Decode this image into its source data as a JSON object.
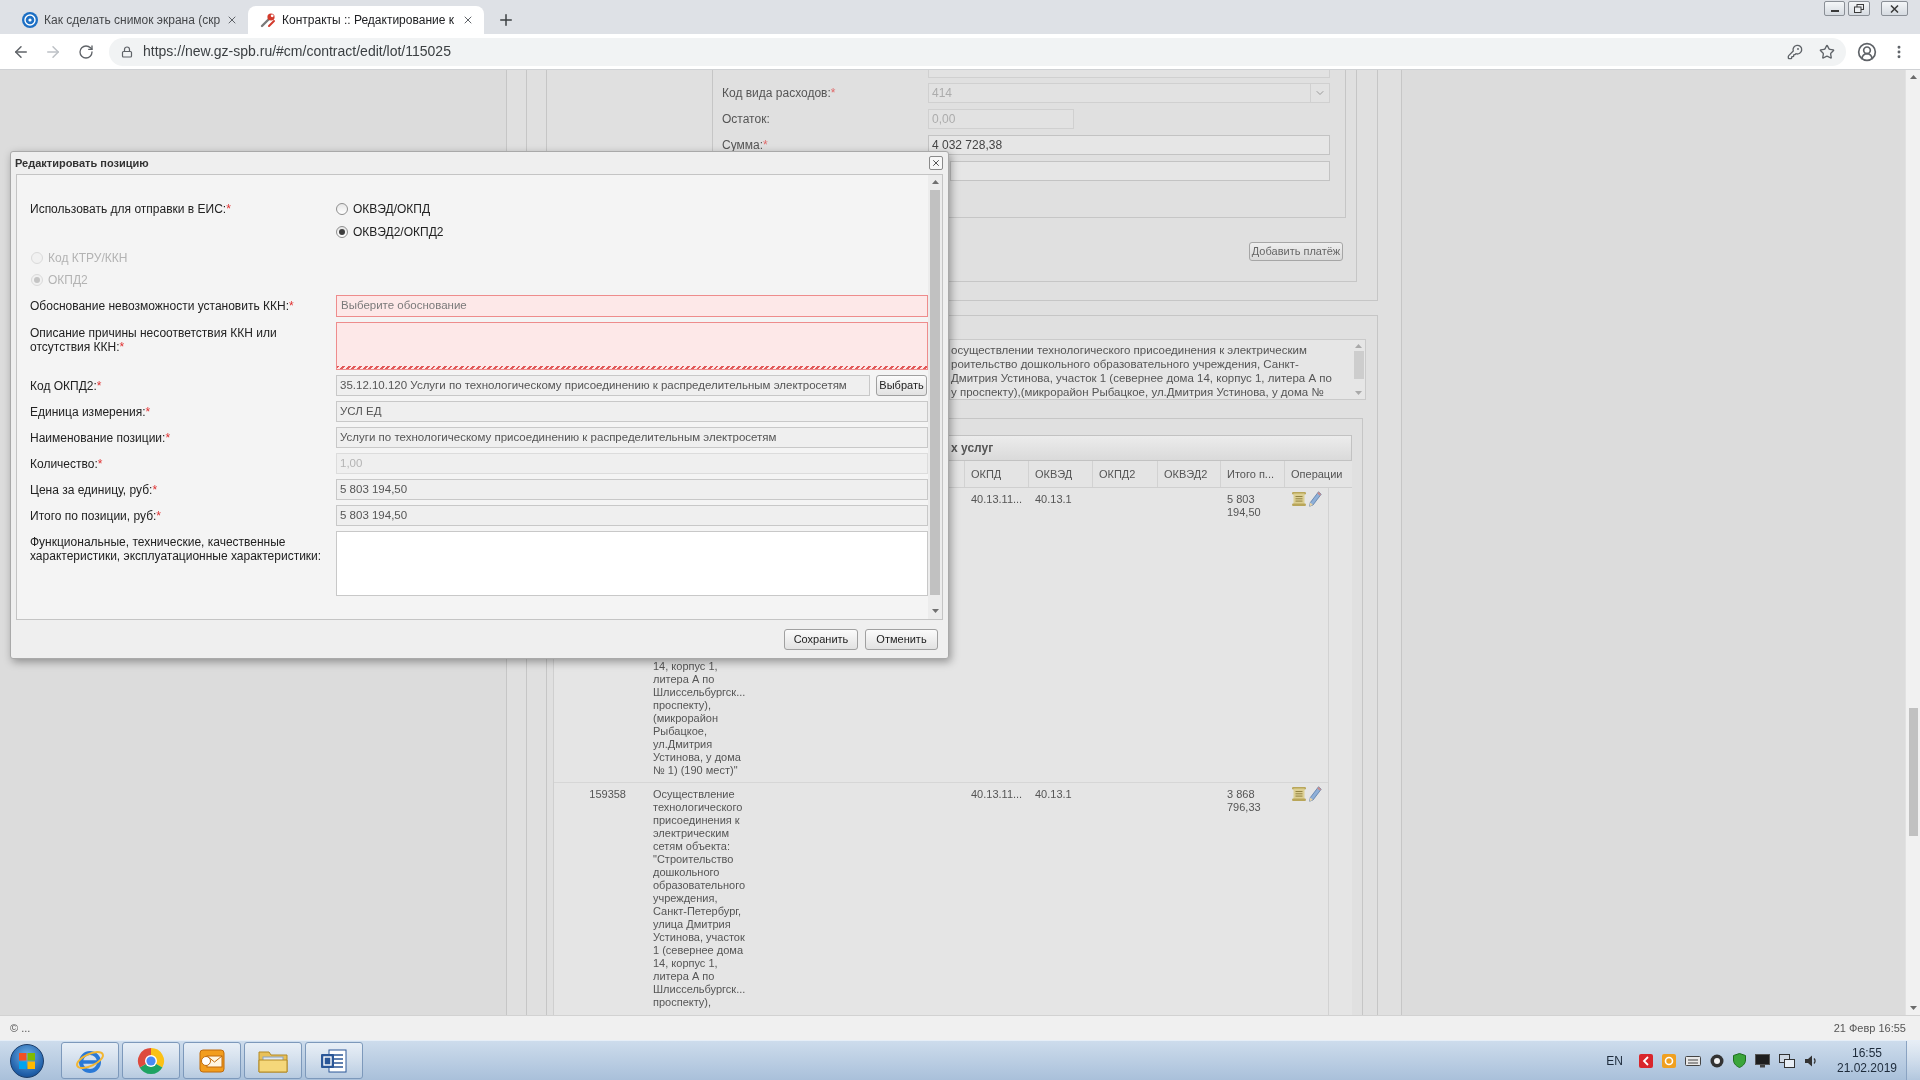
{
  "browser": {
    "tabs": [
      {
        "title": "Как сделать снимок экрана (скр",
        "selected": false,
        "kind": "help"
      },
      {
        "title": "Контракты :: Редактирование к",
        "selected": true,
        "kind": "tools"
      }
    ],
    "url": "https://new.gz-spb.ru/#cm/contract/edit/lot/115025"
  },
  "background_form": {
    "fields": [
      {
        "kind": "select",
        "label": "Код вида расходов:",
        "required_mark": "*",
        "value": "414",
        "disabled": true
      },
      {
        "kind": "short",
        "label": "Остаток:",
        "value": "0,00",
        "disabled": true
      },
      {
        "kind": "text",
        "label": "Сумма:",
        "required_mark": "*",
        "value": "4 032 728,38",
        "disabled": false
      },
      {
        "kind": "text",
        "disabled": false
      }
    ],
    "add_payment_button": "Добавить платёж"
  },
  "description": {
    "lines": [
      "осуществлении технологического присоединения к электрическим",
      "роительство дошкольного образовательного учреждения, Санкт-",
      "Дмитрия Устинова, участок 1 (севернее дома 14, корпус 1, литера А по",
      "у проспекту),(микрорайон Рыбацкое, ул.Дмитрия Устинова, у дома №"
    ]
  },
  "grid": {
    "title": "х услуг",
    "columns": [
      "ОКПД",
      "ОКВЭД",
      "ОКПД2",
      "ОКВЭД2",
      "Итого п...",
      "Операции"
    ],
    "rows": [
      {
        "description_lines": [
          "14, корпус 1,",
          "литера А по",
          "Шлиссельбургск...",
          "проспекту),",
          "(микрорайон",
          "Рыбацкое,",
          "ул.Дмитрия",
          "Устинова, у дома",
          "№ 1) (190 мест)\""
        ],
        "okpd": "40.13.11...",
        "okved": "40.13.1",
        "total": "5 803 194,50"
      },
      {
        "id": "159358",
        "description_lines": [
          "Осуществление",
          "технологического",
          "присоединения к",
          "электрическим",
          "сетям объекта:",
          "\"Строительство",
          "дошкольного",
          "образовательного",
          "учреждения,",
          "Санкт-Петербург,",
          "улица Дмитрия",
          "Устинова, участок",
          "1 (севернее дома",
          "14, корпус 1,",
          "литера А по",
          "Шлиссельбургск...",
          "проспекту),"
        ],
        "okpd": "40.13.11...",
        "okved": "40.13.1",
        "total": "3 868 796,33"
      }
    ]
  },
  "dialog": {
    "title": "Редактировать позицию",
    "send_label": "Использовать для отправки в ЕИС:",
    "send_required_mark": "*",
    "send_options": [
      {
        "label": "ОКВЭД/ОКПД",
        "selected": false
      },
      {
        "label": "ОКВЭД2/ОКПД2",
        "selected": true
      }
    ],
    "code_options": [
      {
        "label": "Код КТРУ/ККН",
        "selected": false,
        "disabled": true
      },
      {
        "label": "ОКПД2",
        "selected": true,
        "disabled": true
      }
    ],
    "fields": [
      {
        "kind": "select",
        "label": "Обоснование невозможности установить ККН:",
        "required_mark": "*",
        "placeholder": "Выберите обоснование",
        "invalid": true,
        "readonly": false,
        "disabled": false
      },
      {
        "kind": "textarea",
        "label": "Описание причины несоответствия ККН или отсутствия ККН:",
        "required_mark": "*",
        "invalid": true,
        "readonly": false,
        "disabled": false
      },
      {
        "kind": "picker",
        "label": "Код ОКПД2:",
        "required_mark": "*",
        "value": "35.12.10.120 Услуги по технологическому присоединению к распределительным электросетям",
        "button": "Выбрать",
        "invalid": false,
        "readonly": true,
        "disabled": false
      },
      {
        "kind": "text",
        "label": "Единица измерения:",
        "required_mark": "*",
        "value": "УСЛ ЕД",
        "invalid": false,
        "readonly": true,
        "disabled": false
      },
      {
        "kind": "text",
        "label": "Наименование позиции:",
        "required_mark": "*",
        "value": "Услуги по технологическому присоединению к распределительным электросетям",
        "invalid": false,
        "readonly": true,
        "disabled": false
      },
      {
        "kind": "text",
        "label": "Количество:",
        "required_mark": "*",
        "value": "1,00",
        "invalid": false,
        "readonly": true,
        "disabled": true
      },
      {
        "kind": "text",
        "label": "Цена за единицу, руб:",
        "required_mark": "*",
        "value": "5 803 194,50",
        "invalid": false,
        "readonly": true,
        "disabled": false
      },
      {
        "kind": "text",
        "label": "Итого по позиции, руб:",
        "required_mark": "*",
        "value": "5 803 194,50",
        "invalid": false,
        "readonly": true,
        "disabled": false
      },
      {
        "kind": "textarea",
        "label": "Функциональные, технические, качественные характеристики, эксплуатационные характеристики:",
        "invalid": false,
        "readonly": false,
        "disabled": false
      }
    ],
    "buttons": [
      "Сохранить",
      "Отменить"
    ]
  },
  "status_bar": {
    "left": "© ...",
    "right": "21 Февр 16:55"
  },
  "taskbar": {
    "language": "EN",
    "time": "16:55",
    "date": "21.02.2019"
  }
}
